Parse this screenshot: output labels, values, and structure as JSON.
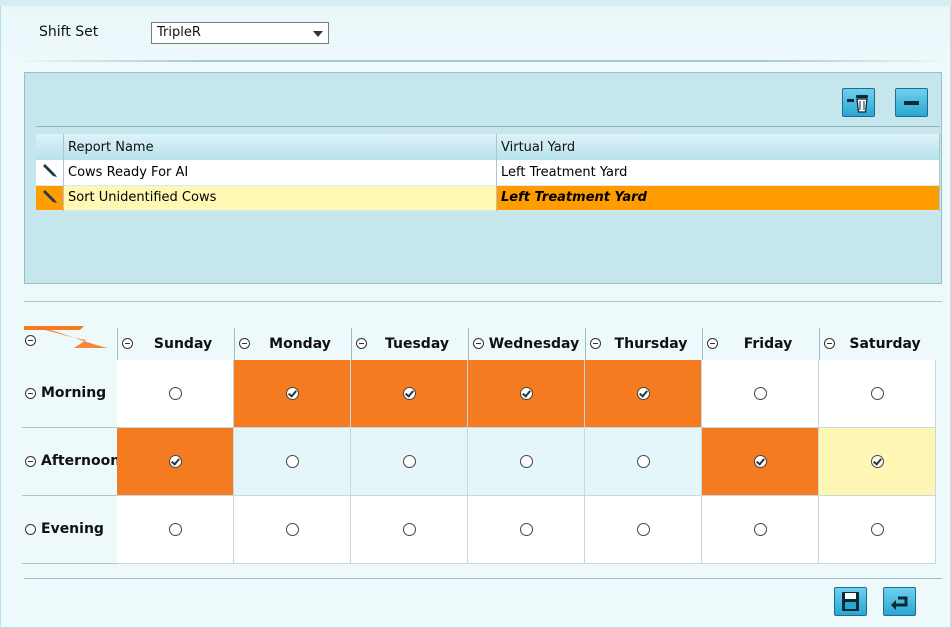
{
  "shift_set": {
    "label": "Shift Set",
    "selected": "TripleR"
  },
  "report_table": {
    "columns": [
      "Report Name",
      "Virtual Yard"
    ],
    "rows": [
      {
        "name": "Cows Ready For AI",
        "yard": "Left Treatment Yard",
        "selected": false
      },
      {
        "name": "Sort Unidentified Cows",
        "yard": "Left Treatment Yard",
        "selected": true
      }
    ]
  },
  "schedule": {
    "days": [
      "Sunday",
      "Monday",
      "Tuesday",
      "Wednesday",
      "Thursday",
      "Friday",
      "Saturday"
    ],
    "shifts": [
      {
        "label": "Morning",
        "checked": [
          false,
          true,
          true,
          true,
          true,
          false,
          false
        ]
      },
      {
        "label": "Afternoon",
        "checked": [
          true,
          false,
          false,
          false,
          false,
          true,
          true
        ]
      },
      {
        "label": "Evening",
        "checked": [
          false,
          false,
          false,
          false,
          false,
          false,
          false
        ]
      }
    ]
  },
  "colors": {
    "accent_orange": "#f47b20",
    "highlight_yellow": "#fdf6b5",
    "row_tint": "#e4f6f9",
    "button_blue": "#2aa6d2"
  },
  "icons": {
    "edit": "pencil-icon",
    "delete": "trash-icon",
    "remove": "minus-icon",
    "save": "floppy-disk-icon",
    "back": "return-arrow-icon"
  }
}
